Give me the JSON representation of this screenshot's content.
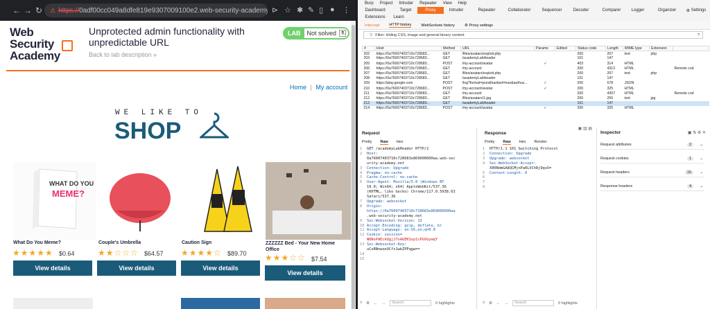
{
  "browser": {
    "url_scheme": "https://",
    "url_rest": "0adf00cc049a8dfe819e9307009100e2.web-security-academy.net"
  },
  "lab": {
    "logo_line1": "Web Security",
    "logo_line2": "Academy",
    "title": "Unprotected admin functionality with unpredictable URL",
    "back_link": "Back to lab description »",
    "badge": "LAB",
    "status": "Not solved"
  },
  "site_nav": {
    "home": "Home",
    "sep": "|",
    "account": "My account"
  },
  "hero": {
    "tagline": "WE LIKE TO",
    "shop": "SHOP"
  },
  "products": [
    {
      "name": "What Do You Meme?",
      "stars": "★★★★★",
      "price": "$0.64",
      "rating": 5
    },
    {
      "name": "Couple's Umbrella",
      "stars": "★★☆☆☆",
      "price": "$64.57",
      "rating": 2
    },
    {
      "name": "Caution Sign",
      "stars": "★★★★☆",
      "price": "$89.70",
      "rating": 4
    },
    {
      "name": "ZZZZZZ Bed - Your New Home Office",
      "stars": "★★★☆☆",
      "price": "$7.54",
      "rating": 3
    }
  ],
  "view_details": "View details",
  "burp": {
    "menu": [
      "Burp",
      "Project",
      "Intruder",
      "Repeater",
      "View",
      "Help"
    ],
    "tabs_row1": [
      "Dashboard",
      "Target",
      "Proxy",
      "Intruder",
      "Repeater",
      "Collaborator",
      "Sequencer",
      "Decoder",
      "Comparer",
      "Logger",
      "Organizer",
      "Settings"
    ],
    "tabs_row2": [
      "Extensions",
      "Learn"
    ],
    "subtabs": [
      "Intercept",
      "HTTP history",
      "WebSockets history",
      "Proxy settings"
    ],
    "filter": "Filter: Hiding CSS, image and general binary content",
    "columns": [
      "#",
      "Host",
      "Method",
      "URL",
      "Params",
      "Edited",
      "Status code",
      "Length",
      "MIME type",
      "Extension",
      ""
    ],
    "rows": [
      [
        "202",
        "https://0a76007403710c728683...",
        "GET",
        "/files/avatars/exploit.php",
        "",
        "",
        "200",
        "207",
        "text",
        "php",
        ""
      ],
      [
        "203",
        "https://0a76007403710c728683...",
        "GET",
        "/academyLabHeader",
        "",
        "",
        "101",
        "147",
        "",
        "",
        ""
      ],
      [
        "205",
        "https://0a76007403710c728683...",
        "POST",
        "/my-account/avatar",
        "✓",
        "",
        "403",
        "314",
        "HTML",
        "",
        ""
      ],
      [
        "206",
        "https://0a76007403710c728683...",
        "GET",
        "/my-account",
        "",
        "",
        "200",
        "4313",
        "HTML",
        "",
        "Remote cod"
      ],
      [
        "207",
        "https://0a76007403710c728683...",
        "GET",
        "/files/avatars/exploit.php",
        "",
        "",
        "200",
        "207",
        "text",
        "php",
        ""
      ],
      [
        "208",
        "https://0a76007403710c728683...",
        "GET",
        "/academyLabHeader",
        "",
        "",
        "101",
        "147",
        "",
        "",
        ""
      ],
      [
        "209",
        "https://play.google.com",
        "POST",
        "/log?format=json&hasfast=true&authus...",
        "✓",
        "",
        "200",
        "578",
        "JSON",
        "",
        ""
      ],
      [
        "210",
        "https://0a76007403710c728683...",
        "POST",
        "/my-account/avatar",
        "✓",
        "",
        "200",
        "325",
        "HTML",
        "",
        ""
      ],
      [
        "211",
        "https://0a76007403710c728683...",
        "GET",
        "/my-account",
        "",
        "",
        "200",
        "4307",
        "HTML",
        "",
        "Remote cod"
      ],
      [
        "212",
        "https://0a76007403710c728683...",
        "GET",
        "/files/avatars/1.jpg",
        "",
        "",
        "200",
        "255",
        "text",
        "jpg",
        ""
      ],
      [
        "213",
        "https://0a76007403710c728683...",
        "GET",
        "/academyLabHeader",
        "",
        "",
        "101",
        "147",
        "",
        "",
        ""
      ],
      [
        "214",
        "https://0a76007403710c728683...",
        "POST",
        "/my-account/avatar",
        "✓",
        "",
        "200",
        "325",
        "HTML",
        "",
        ""
      ]
    ],
    "request": {
      "title": "Request",
      "tabs": [
        "Pretty",
        "Raw",
        "Hex"
      ],
      "lines": [
        [
          "1",
          "GET /academyLabHeader HTTP/2",
          ""
        ],
        [
          "2",
          "Host:",
          ""
        ],
        [
          "",
          "0a76007403710c728683e869000600aa.web-sec",
          ""
        ],
        [
          "",
          "urity-academy.net",
          ""
        ],
        [
          "3",
          "Connection: Upgrade",
          ""
        ],
        [
          "4",
          "Pragma: no-cache",
          ""
        ],
        [
          "5",
          "Cache-Control: no-cache",
          ""
        ],
        [
          "6",
          "User-Agent: Mozilla/5.0 (Windows NT",
          ""
        ],
        [
          "",
          "10.0; Win64; x64) AppleWebKit/537.36",
          ""
        ],
        [
          "",
          "(KHTML, like Gecko) Chrome/117.0.5938.63",
          ""
        ],
        [
          "",
          "Safari/537.36",
          ""
        ],
        [
          "7",
          "Upgrade: websocket",
          ""
        ],
        [
          "8",
          "Origin:",
          ""
        ],
        [
          "",
          "https://0a76007403710c728683e869000600aa",
          ""
        ],
        [
          "",
          ".web-security-academy.net",
          ""
        ],
        [
          "9",
          "Sec-Websocket-Version: 13",
          ""
        ],
        [
          "10",
          "Accept-Encoding: gzip, deflate, br",
          ""
        ],
        [
          "11",
          "Accept-Language: en-US,en;q=0.9",
          ""
        ],
        [
          "12",
          "Cookie: session=",
          ""
        ],
        [
          "",
          "WDNsPAEckQgjJ7sAGEKSsp1cPGVGymqY",
          "red"
        ],
        [
          "13",
          "Sec-Websocket-Key:",
          ""
        ],
        [
          "",
          "uCoRNnwoeOCfz1wbZPPqgw==",
          ""
        ],
        [
          "14",
          "",
          ""
        ],
        [
          "15",
          "",
          ""
        ]
      ]
    },
    "response": {
      "title": "Response",
      "tabs": [
        "Pretty",
        "Raw",
        "Hex",
        "Render"
      ],
      "lines": [
        [
          "1",
          "HTTP/1.1 101 Switching Protocol"
        ],
        [
          "2",
          "Connection: Upgrade"
        ],
        [
          "3",
          "Upgrade: websocket"
        ],
        [
          "4",
          "Sec-WebSocket-Accept:"
        ],
        [
          "",
          "X00BdmGA8QCMjnPa0LVChRj9qvU="
        ],
        [
          "5",
          "Content-Length: 0"
        ],
        [
          "6",
          ""
        ],
        [
          "7",
          ""
        ],
        [
          "8",
          ""
        ]
      ]
    },
    "inspector": {
      "title": "Inspector",
      "rows": [
        {
          "label": "Request attributes",
          "count": "2"
        },
        {
          "label": "Request cookies",
          "count": "1"
        },
        {
          "label": "Request headers",
          "count": "15"
        },
        {
          "label": "Response headers",
          "count": "4"
        }
      ]
    },
    "search_placeholder": "Search",
    "highlights": "0 highlights",
    "colors": {
      "accent": "#f66f1e",
      "selected_row": "#cfe3f7"
    }
  }
}
